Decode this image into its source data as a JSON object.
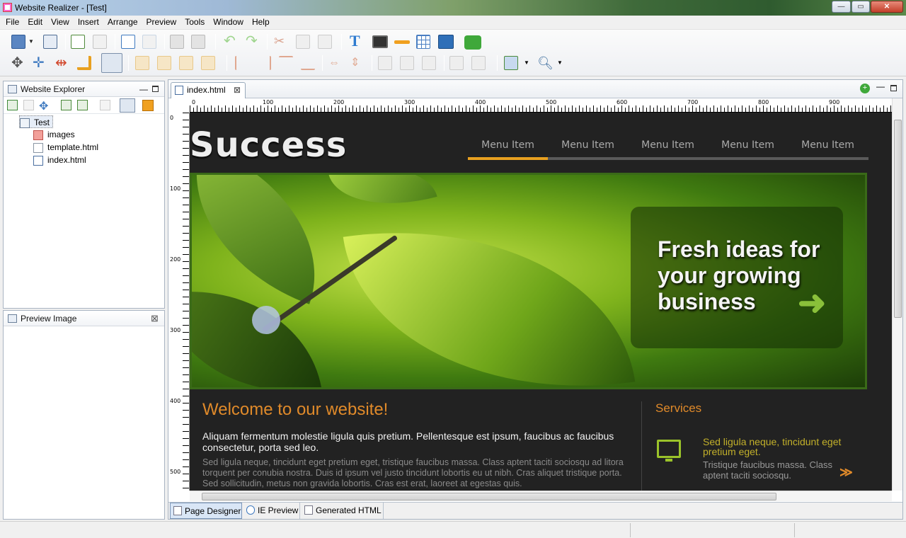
{
  "window": {
    "title": "Website Realizer - [Test]",
    "minimize": "—",
    "maximize": "▭",
    "close": "✕"
  },
  "menu": [
    "File",
    "Edit",
    "View",
    "Insert",
    "Arrange",
    "Preview",
    "Tools",
    "Window",
    "Help"
  ],
  "explorer": {
    "title": "Website Explorer",
    "tree": {
      "root": "Test",
      "children": [
        "images",
        "template.html",
        "index.html"
      ]
    }
  },
  "preview_panel": {
    "title": "Preview Image"
  },
  "editor": {
    "active_tab": "index.html",
    "ruler_h": [
      "0",
      "100",
      "200",
      "300",
      "400",
      "500",
      "600",
      "700",
      "800",
      "900"
    ],
    "ruler_v": [
      "0",
      "100",
      "200",
      "300",
      "400",
      "500"
    ],
    "bottom_tabs": [
      "Page Designer",
      "IE Preview",
      "Generated HTML"
    ]
  },
  "site": {
    "logo": "Success",
    "nav": [
      "Menu Item",
      "Menu Item",
      "Menu Item",
      "Menu Item",
      "Menu Item"
    ],
    "active_nav_index": 0,
    "hero_text": "Fresh ideas for your growing business",
    "welcome_title": "Welcome to our website!",
    "lead": "Aliquam fermentum molestie ligula quis pretium. Pellentesque est ipsum, faucibus ac faucibus consectetur, porta sed leo.",
    "body": "Sed ligula neque, tincidunt eget pretium eget, tristique faucibus massa. Class aptent taciti sociosqu ad litora torquent per conubia nostra. Duis id ipsum vel justo tincidunt lobortis eu ut nibh. Cras aliquet tristique porta. Sed sollicitudin, metus non gravida lobortis. Cras est erat, laoreet at egestas quis.",
    "services_title": "Services",
    "service_item_title": "Sed ligula neque, tincidunt eget pretium eget.",
    "service_item_body": "Tristique faucibus massa. Class aptent taciti sociosqu.",
    "more_glyph": "≫",
    "accent_color": "#e08a2a"
  }
}
